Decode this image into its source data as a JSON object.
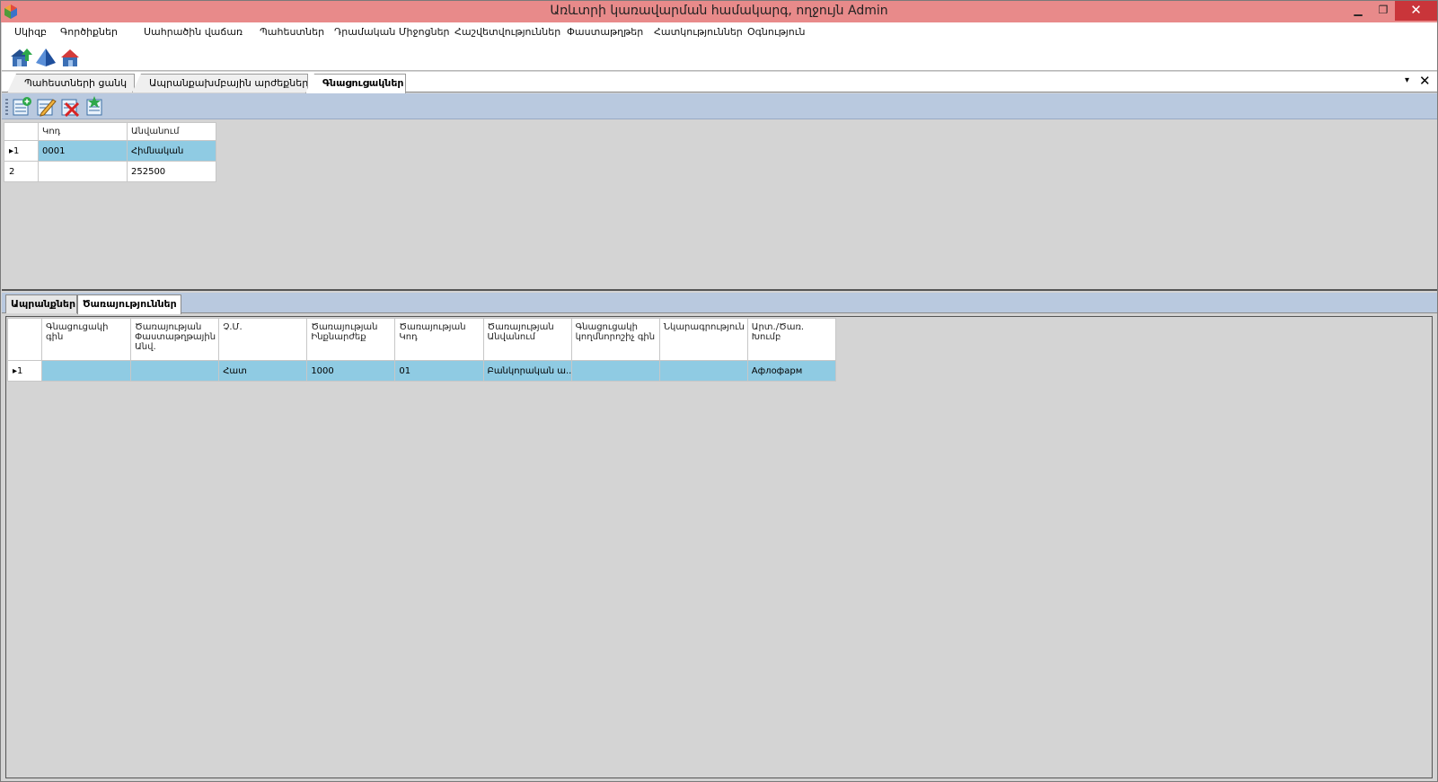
{
  "window": {
    "title": "Առևտրի կառավարման համակարգ, ողջույն Admin",
    "minimize_glyph": "▁",
    "maximize_glyph": "❐",
    "close_glyph": "✕"
  },
  "menu": {
    "items": [
      {
        "label": "Սկիզբ"
      },
      {
        "label": "Գործիքներ"
      },
      {
        "label": "Սահրածին վաճառ"
      },
      {
        "label": "Պահեստներ"
      },
      {
        "label": "Դրամական Միջոցներ"
      },
      {
        "label": "Հաշվետվություններ"
      },
      {
        "label": "Փաստաթղթեր"
      },
      {
        "label": "Հատկություններ"
      },
      {
        "label": "Օգնություն"
      }
    ]
  },
  "app_toolbar": {
    "icons": [
      "house-up-icon",
      "pyramid-icon",
      "house-red-icon"
    ]
  },
  "doc_tabs": {
    "tabs": [
      {
        "label": "Պահեստների ցանկ",
        "active": false
      },
      {
        "label": "Ապրանքախմբային արժեքներ...",
        "active": false
      },
      {
        "label": "Գնացուցակներ",
        "active": true
      }
    ],
    "menu_glyph": "▾",
    "close_glyph": "✕"
  },
  "grid_toolbar": {
    "icons": [
      "add-row-icon",
      "edit-row-icon",
      "delete-row-icon",
      "save-row-icon"
    ]
  },
  "top_grid": {
    "columns": [
      "Կոդ",
      "Անվանում"
    ],
    "rows": [
      {
        "num": "1",
        "marker": "▸",
        "code": "0001",
        "name": "Հիմնական",
        "selected": true
      },
      {
        "num": "2",
        "marker": "",
        "code": "",
        "name": "252500",
        "selected": false
      }
    ]
  },
  "sub_tabs": {
    "tabs": [
      {
        "label": "Ապրանքներ",
        "active": false
      },
      {
        "label": "Ծառայություններ",
        "active": true
      }
    ]
  },
  "bottom_grid": {
    "columns": [
      "Գնացուցակի գին",
      "Ծառայության Փաստաթղթային Անվ.",
      "Չ.Մ.",
      "Ծառայության Ինքնարժեք",
      "Ծառայության Կոդ",
      "Ծառայության Անվանում",
      "Գնացուցակի կողմնորոշիչ գին",
      "Նկարագրություն",
      "Արտ./Ծառ. Խումբ"
    ],
    "rows": [
      {
        "num": "1",
        "marker": "▸",
        "cells": [
          "",
          "",
          "Հատ",
          "1000",
          "01",
          "Բանկորական ա...",
          "",
          "",
          "Афлофарм"
        ],
        "selected": true
      }
    ]
  },
  "colors": {
    "titlebar": "#e88a8a",
    "close_button": "#c9353a",
    "toolbar_blue": "#b9c9df",
    "selected_row": "#8fcbe3",
    "background": "#d4d4d4"
  }
}
